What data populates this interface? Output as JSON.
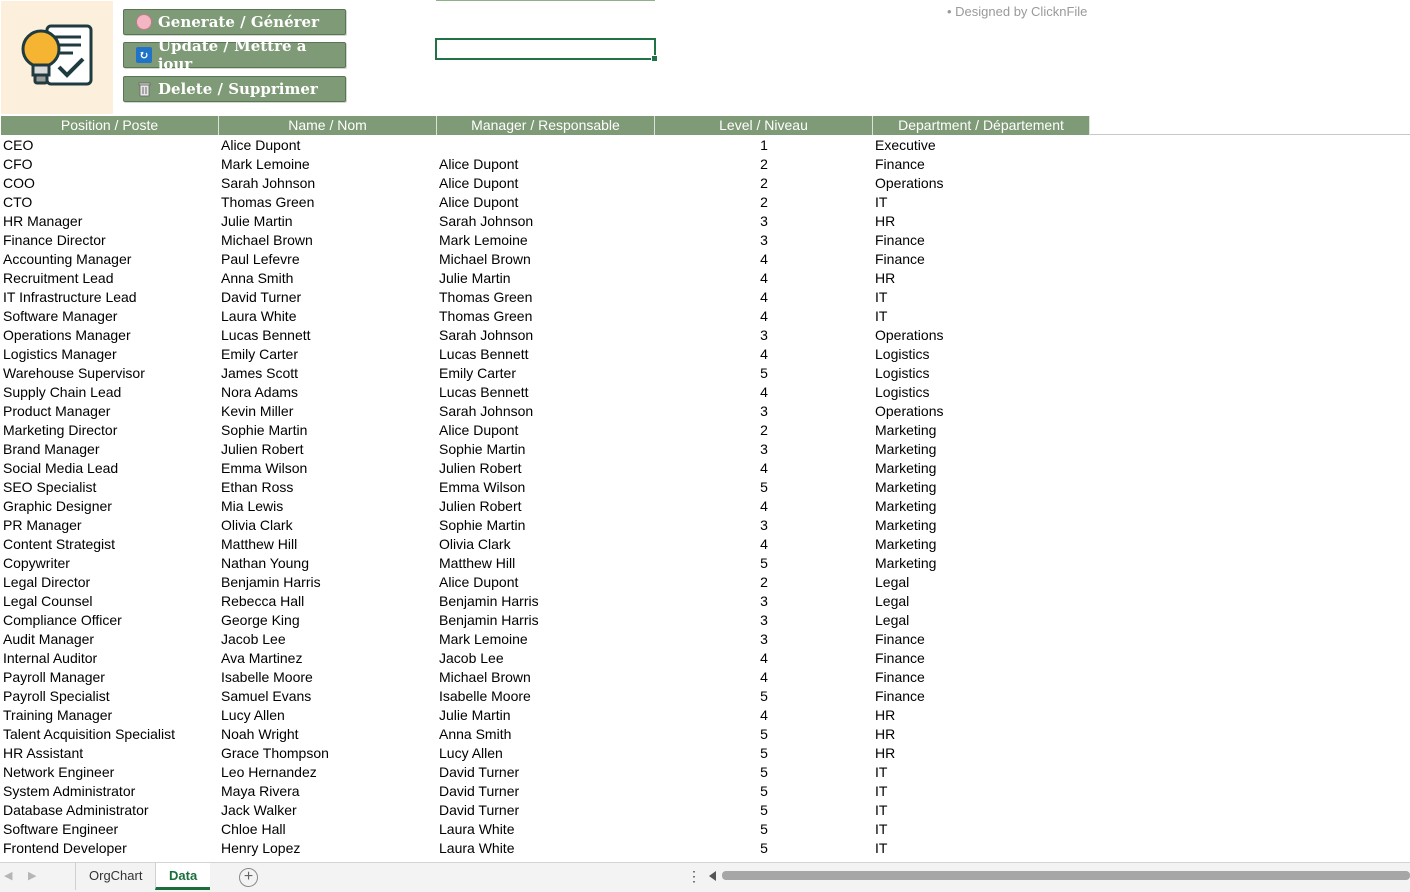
{
  "buttons": {
    "generate": "Generate / Générer",
    "update": "Update / Mettre à jour",
    "delete": "Delete / Supprimer"
  },
  "credit": "• Designed by ClicknFile",
  "columns": [
    "Position / Poste",
    "Name / Nom",
    "Manager / Responsable",
    "Level / Niveau",
    "Department / Département"
  ],
  "rows": [
    [
      "CEO",
      "Alice Dupont",
      "",
      "1",
      "Executive"
    ],
    [
      "CFO",
      "Mark Lemoine",
      "Alice Dupont",
      "2",
      "Finance"
    ],
    [
      "COO",
      "Sarah Johnson",
      "Alice Dupont",
      "2",
      "Operations"
    ],
    [
      "CTO",
      "Thomas Green",
      "Alice Dupont",
      "2",
      "IT"
    ],
    [
      "HR Manager",
      "Julie Martin",
      "Sarah Johnson",
      "3",
      "HR"
    ],
    [
      "Finance Director",
      "Michael Brown",
      "Mark Lemoine",
      "3",
      "Finance"
    ],
    [
      "Accounting Manager",
      "Paul Lefevre",
      "Michael Brown",
      "4",
      "Finance"
    ],
    [
      "Recruitment Lead",
      "Anna Smith",
      "Julie Martin",
      "4",
      "HR"
    ],
    [
      "IT Infrastructure Lead",
      "David Turner",
      "Thomas Green",
      "4",
      "IT"
    ],
    [
      "Software Manager",
      "Laura White",
      "Thomas Green",
      "4",
      "IT"
    ],
    [
      "Operations Manager",
      "Lucas Bennett",
      "Sarah Johnson",
      "3",
      "Operations"
    ],
    [
      "Logistics Manager",
      "Emily Carter",
      "Lucas Bennett",
      "4",
      "Logistics"
    ],
    [
      "Warehouse Supervisor",
      "James Scott",
      "Emily Carter",
      "5",
      "Logistics"
    ],
    [
      "Supply Chain Lead",
      "Nora Adams",
      "Lucas Bennett",
      "4",
      "Logistics"
    ],
    [
      "Product Manager",
      "Kevin Miller",
      "Sarah Johnson",
      "3",
      "Operations"
    ],
    [
      "Marketing Director",
      "Sophie Martin",
      "Alice Dupont",
      "2",
      "Marketing"
    ],
    [
      "Brand Manager",
      "Julien Robert",
      "Sophie Martin",
      "3",
      "Marketing"
    ],
    [
      "Social Media Lead",
      "Emma Wilson",
      "Julien Robert",
      "4",
      "Marketing"
    ],
    [
      "SEO Specialist",
      "Ethan Ross",
      "Emma Wilson",
      "5",
      "Marketing"
    ],
    [
      "Graphic Designer",
      "Mia Lewis",
      "Julien Robert",
      "4",
      "Marketing"
    ],
    [
      "PR Manager",
      "Olivia Clark",
      "Sophie Martin",
      "3",
      "Marketing"
    ],
    [
      "Content Strategist",
      "Matthew Hill",
      "Olivia Clark",
      "4",
      "Marketing"
    ],
    [
      "Copywriter",
      "Nathan Young",
      "Matthew Hill",
      "5",
      "Marketing"
    ],
    [
      "Legal Director",
      "Benjamin Harris",
      "Alice Dupont",
      "2",
      "Legal"
    ],
    [
      "Legal Counsel",
      "Rebecca Hall",
      "Benjamin Harris",
      "3",
      "Legal"
    ],
    [
      "Compliance Officer",
      "George King",
      "Benjamin Harris",
      "3",
      "Legal"
    ],
    [
      "Audit Manager",
      "Jacob Lee",
      "Mark Lemoine",
      "3",
      "Finance"
    ],
    [
      "Internal Auditor",
      "Ava Martinez",
      "Jacob Lee",
      "4",
      "Finance"
    ],
    [
      "Payroll Manager",
      "Isabelle Moore",
      "Michael Brown",
      "4",
      "Finance"
    ],
    [
      "Payroll Specialist",
      "Samuel Evans",
      "Isabelle Moore",
      "5",
      "Finance"
    ],
    [
      "Training Manager",
      "Lucy Allen",
      "Julie Martin",
      "4",
      "HR"
    ],
    [
      "Talent Acquisition Specialist",
      "Noah Wright",
      "Anna Smith",
      "5",
      "HR"
    ],
    [
      "HR Assistant",
      "Grace Thompson",
      "Lucy Allen",
      "5",
      "HR"
    ],
    [
      "Network Engineer",
      "Leo Hernandez",
      "David Turner",
      "5",
      "IT"
    ],
    [
      "System Administrator",
      "Maya Rivera",
      "David Turner",
      "5",
      "IT"
    ],
    [
      "Database Administrator",
      "Jack Walker",
      "David Turner",
      "5",
      "IT"
    ],
    [
      "Software Engineer",
      "Chloe Hall",
      "Laura White",
      "5",
      "IT"
    ],
    [
      "Frontend Developer",
      "Henry Lopez",
      "Laura White",
      "5",
      "IT"
    ]
  ],
  "tabs": {
    "orgchart": "OrgChart",
    "data": "Data"
  },
  "tabbar": {
    "add": "+",
    "more": "⋮"
  },
  "icons": {
    "generate": "brain-icon",
    "update": "refresh-icon",
    "delete": "trash-icon",
    "logo": "lightbulb-checklist-icon"
  },
  "colors": {
    "accent": "#7f9a76",
    "selection": "#217346",
    "logo_bg": "#fcefdb"
  }
}
